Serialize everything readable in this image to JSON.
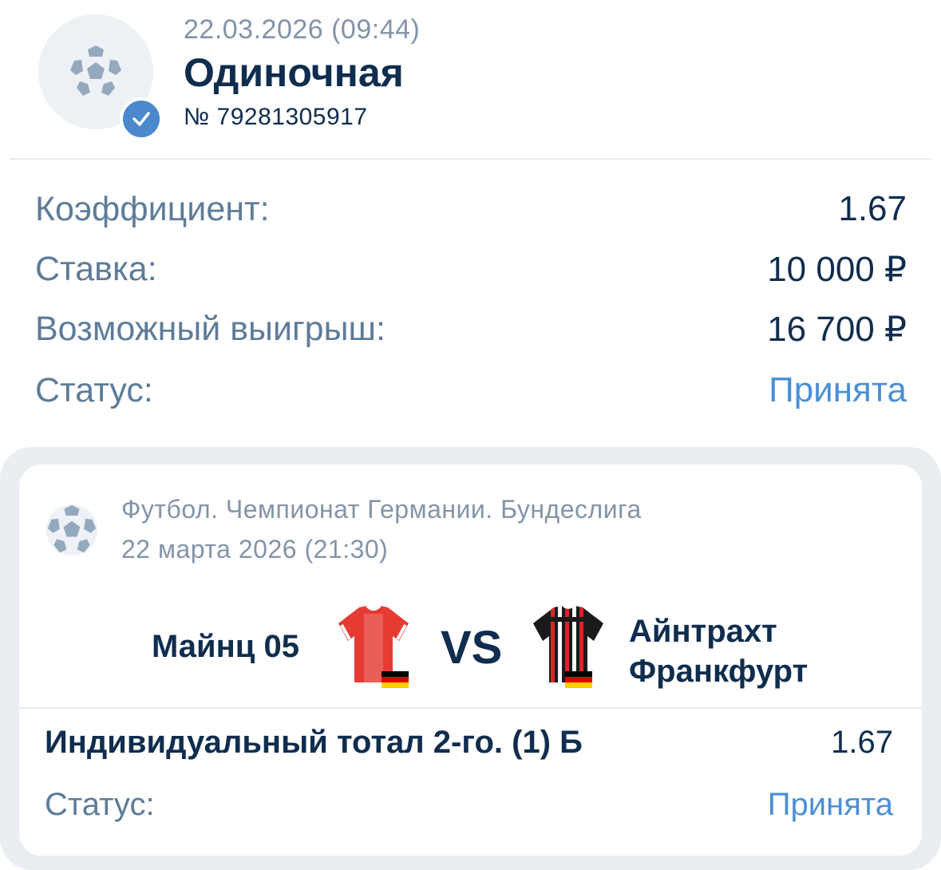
{
  "header": {
    "datetime": "22.03.2026 (09:44)",
    "bet_type": "Одиночная",
    "bet_number": "№ 79281305917",
    "icons": {
      "sport": "soccer-ball-icon",
      "badge": "checkmark-icon"
    }
  },
  "summary": {
    "odds_label": "Коэффициент:",
    "odds_value": "1.67",
    "stake_label": "Ставка:",
    "stake_value": "10 000 ₽",
    "payout_label": "Возможный выигрыш:",
    "payout_value": "16 700 ₽",
    "status_label": "Статус:",
    "status_value": "Принята"
  },
  "event": {
    "league": "Футбол. Чемпионат Германии. Бундеслига",
    "date": "22 марта 2026 (21:30)",
    "home_team": "Майнц 05",
    "vs": "VS",
    "away_team_line1": "Айнтрахт",
    "away_team_line2": "Франкфурт",
    "market": "Индивидуальный тотал 2-го. (1) Б",
    "market_odds": "1.67",
    "status_label": "Статус:",
    "status_value": "Принята"
  },
  "colors": {
    "primary_text": "#0f2d4e",
    "secondary_text": "#5e7c99",
    "muted_text": "#8394a8",
    "accent": "#4b8fd6",
    "badge": "#4b88cc",
    "card_bg": "#eaeef3"
  }
}
